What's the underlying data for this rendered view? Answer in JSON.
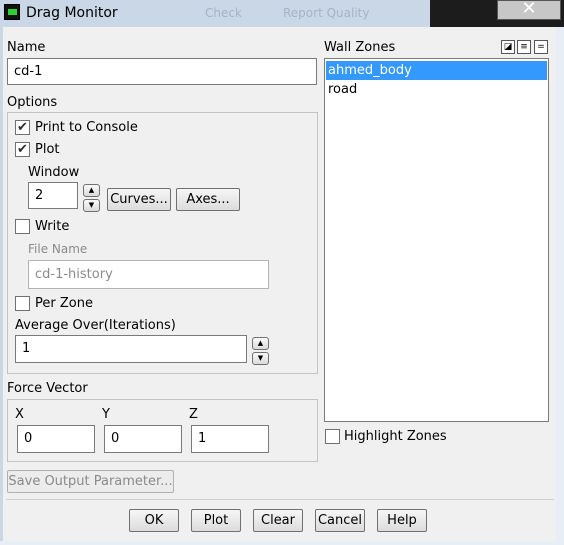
{
  "window": {
    "title": "Drag Monitor",
    "close_glyph": "✕",
    "background_text": [
      "Check",
      "Report Quality"
    ]
  },
  "name": {
    "label": "Name",
    "value": "cd-1"
  },
  "options": {
    "label": "Options",
    "print_to_console": {
      "label": "Print to Console",
      "checked": true
    },
    "plot": {
      "label": "Plot",
      "checked": true
    },
    "window_label": "Window",
    "window_value": "2",
    "curves_button": "Curves...",
    "axes_button": "Axes...",
    "write": {
      "label": "Write",
      "checked": false
    },
    "file_name_label": "File Name",
    "file_name_value": "cd-1-history",
    "per_zone": {
      "label": "Per Zone",
      "checked": false
    },
    "average_over_label": "Average Over(Iterations)",
    "average_over_value": "1"
  },
  "force_vector": {
    "label": "Force Vector",
    "x_label": "X",
    "x_value": "0",
    "y_label": "Y",
    "y_value": "0",
    "z_label": "Z",
    "z_value": "1"
  },
  "save_output_parameter": "Save Output Parameter...",
  "wall_zones": {
    "label": "Wall Zones",
    "items": [
      "ahmed_body",
      "road"
    ],
    "selected_index": 0,
    "tools": [
      "select-all-icon",
      "list-icon",
      "deselect-icon"
    ]
  },
  "highlight_zones": {
    "label": "Highlight Zones",
    "checked": false
  },
  "buttons": {
    "ok": "OK",
    "plot": "Plot",
    "clear": "Clear",
    "cancel": "Cancel",
    "help": "Help"
  },
  "colors": {
    "selection": "#3399ff",
    "title_bar": "#c9d7e6"
  }
}
